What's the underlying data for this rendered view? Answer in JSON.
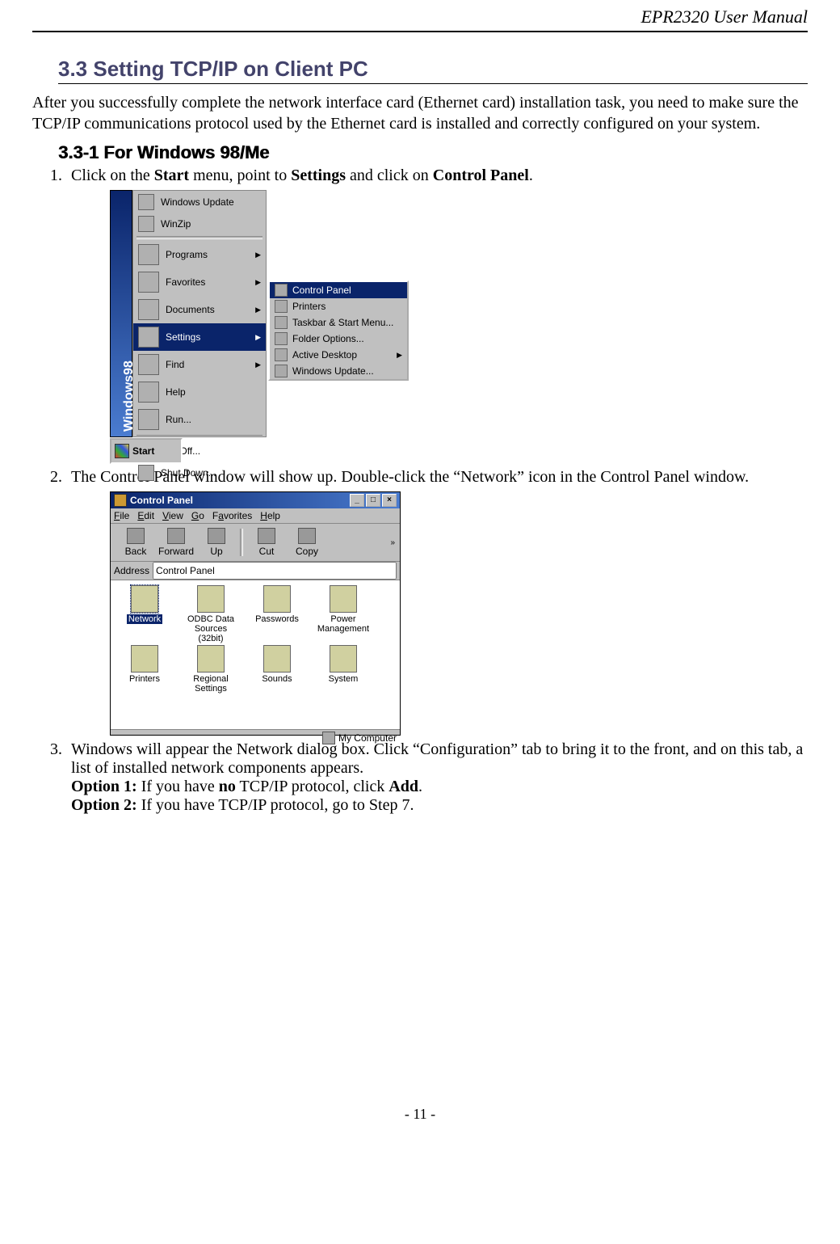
{
  "header": {
    "running": "EPR2320 User Manual"
  },
  "section": {
    "num_title": "3.3 Setting TCP/IP on Client PC",
    "para": "After you successfully complete the network interface card (Ethernet card) installation task, you need to make sure the TCP/IP communications protocol used by the Ethernet card is installed and correctly configured on your system."
  },
  "subsection": {
    "title": "3.3-1 For Windows 98/Me"
  },
  "step1": {
    "pre": "Click on the ",
    "b1": "Start",
    "mid1": " menu, point to ",
    "b2": "Settings",
    "mid2": " and click on ",
    "b3": "Control Panel",
    "post": "."
  },
  "fig1": {
    "side_label": "Windows98",
    "main": [
      "Windows Update",
      "WinZip",
      "Programs",
      "Favorites",
      "Documents",
      "Settings",
      "Find",
      "Help",
      "Run...",
      "Log Off...",
      "Shut Down..."
    ],
    "sub": [
      "Control Panel",
      "Printers",
      "Taskbar & Start Menu...",
      "Folder Options...",
      "Active Desktop",
      "Windows Update..."
    ],
    "start": "Start"
  },
  "step2": {
    "text": "The Control Panel window will show up. Double-click the “Network” icon in the Control Panel window."
  },
  "fig2": {
    "title": "Control Panel",
    "menus": [
      "File",
      "Edit",
      "View",
      "Go",
      "Favorites",
      "Help"
    ],
    "tools": [
      "Back",
      "Forward",
      "Up",
      "Cut",
      "Copy"
    ],
    "addr_label": "Address",
    "addr_value": "Control Panel",
    "icons": [
      "Network",
      "ODBC Data Sources (32bit)",
      "Passwords",
      "Power Management",
      "Printers",
      "Regional Settings",
      "Sounds",
      "System"
    ],
    "status": "My Computer"
  },
  "step3": {
    "l1": "Windows will appear the Network dialog box. Click “Configuration” tab to bring it to the front, and on this tab, a list of installed network components appears.",
    "o1a": "Option 1:",
    "o1b": " If you have ",
    "o1c": "no",
    "o1d": " TCP/IP protocol, click ",
    "o1e": "Add",
    "o1f": ".",
    "o2a": "Option 2:",
    "o2b": " If you have TCP/IP protocol, go to Step 7."
  },
  "footer": {
    "page": "- 11 -"
  }
}
